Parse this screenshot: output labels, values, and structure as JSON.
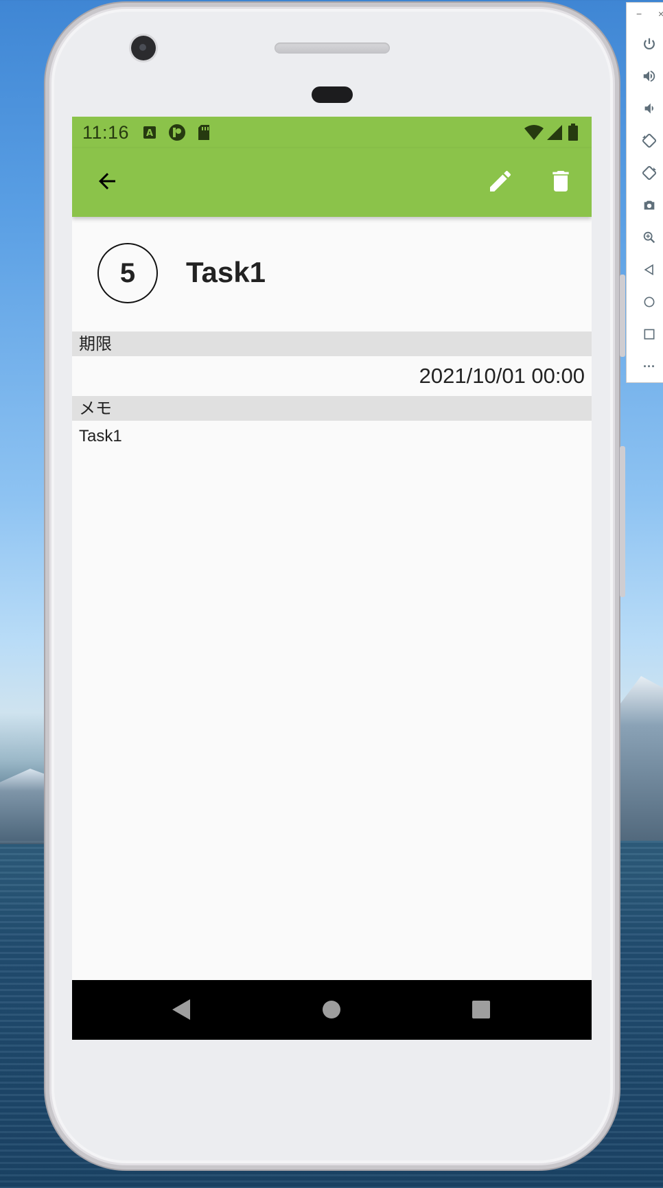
{
  "status_bar": {
    "time": "11:16",
    "notification_icons": [
      "text-a-icon",
      "p-badge-icon",
      "sd-card-icon"
    ],
    "system_icons": [
      "wifi-icon",
      "signal-icon",
      "battery-icon"
    ]
  },
  "toolbar": {
    "color": "#8bc34a",
    "back_icon": "arrow-back-icon",
    "edit_icon": "pencil-icon",
    "delete_icon": "trash-icon"
  },
  "task": {
    "priority": "5",
    "title": "Task1"
  },
  "sections": {
    "due_label": "期限",
    "due_value": "2021/10/01 00:00",
    "memo_label": "メモ",
    "memo_value": "Task1"
  },
  "nav_bar": {
    "buttons": [
      "back-triangle-icon",
      "home-circle-icon",
      "recents-square-icon"
    ]
  },
  "emulator_panel": {
    "window_controls": [
      "−",
      "×"
    ],
    "tools": [
      "power-icon",
      "volume-up-icon",
      "volume-down-icon",
      "rotate-left-icon",
      "rotate-right-icon",
      "camera-icon",
      "zoom-icon",
      "back-icon",
      "home-icon",
      "overview-icon",
      "more-icon"
    ],
    "more_label": "···"
  }
}
